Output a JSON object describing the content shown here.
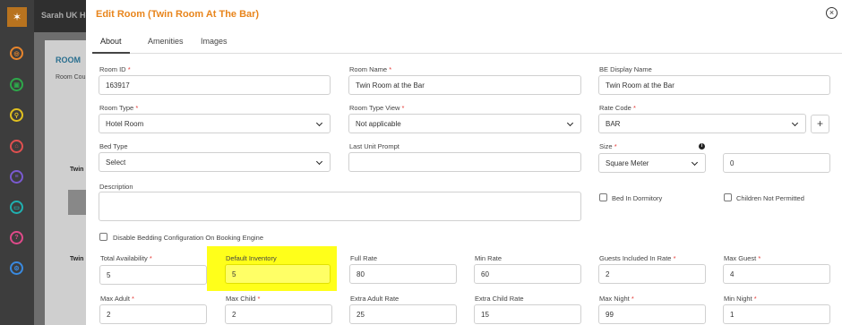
{
  "background": {
    "brand": "Sarah UK Hotel",
    "heading": "ROOM",
    "sub_label": "Room Cou",
    "thumb_label": "Twin"
  },
  "modal": {
    "title": "Edit Room (Twin Room At The Bar)",
    "close_symbol": "×",
    "tabs": [
      "About",
      "Amenities",
      "Images"
    ]
  },
  "form": {
    "room_id": {
      "label": "Room ID",
      "value": "163917"
    },
    "room_name": {
      "label": "Room Name",
      "value": "Twin Room at the Bar"
    },
    "be_display_name": {
      "label": "BE Display Name",
      "value": "Twin Room at the Bar"
    },
    "room_type": {
      "label": "Room Type",
      "value": "Hotel Room"
    },
    "room_type_view": {
      "label": "Room Type View",
      "value": "Not applicable"
    },
    "rate_code": {
      "label": "Rate Code",
      "value": "BAR"
    },
    "add_symbol": "+",
    "bed_type": {
      "label": "Bed Type",
      "value": "Select"
    },
    "last_unit_prompt": {
      "label": "Last Unit Prompt",
      "value": ""
    },
    "size": {
      "label": "Size",
      "unit": "Square Meter",
      "value": "0"
    },
    "info_symbol": "i",
    "description": {
      "label": "Description"
    },
    "bed_in_dormitory": {
      "label": "Bed In Dormitory"
    },
    "children_not_permitted": {
      "label": "Children Not Permitted"
    },
    "disable_bedding": {
      "label": "Disable Bedding Configuration On Booking Engine"
    },
    "total_availability": {
      "label": "Total Availability",
      "value": "5"
    },
    "default_inventory": {
      "label": "Default Inventory",
      "value": "5"
    },
    "full_rate": {
      "label": "Full Rate",
      "value": "80"
    },
    "min_rate": {
      "label": "Min Rate",
      "value": "60"
    },
    "guests_included": {
      "label": "Guests Included In Rate",
      "value": "2"
    },
    "max_guest": {
      "label": "Max Guest",
      "value": "4"
    },
    "max_adult": {
      "label": "Max Adult",
      "value": "2"
    },
    "max_child": {
      "label": "Max Child",
      "value": "2"
    },
    "extra_adult_rate": {
      "label": "Extra Adult Rate",
      "value": "25"
    },
    "extra_child_rate": {
      "label": "Extra Child Rate",
      "value": "15"
    },
    "max_night": {
      "label": "Max Night",
      "value": "99"
    },
    "min_night": {
      "label": "Min Night",
      "value": "1"
    }
  },
  "colors": {
    "accent": "#e8851c",
    "required": "#e53935",
    "highlight": "#ffff1a"
  },
  "required_mark": "*"
}
